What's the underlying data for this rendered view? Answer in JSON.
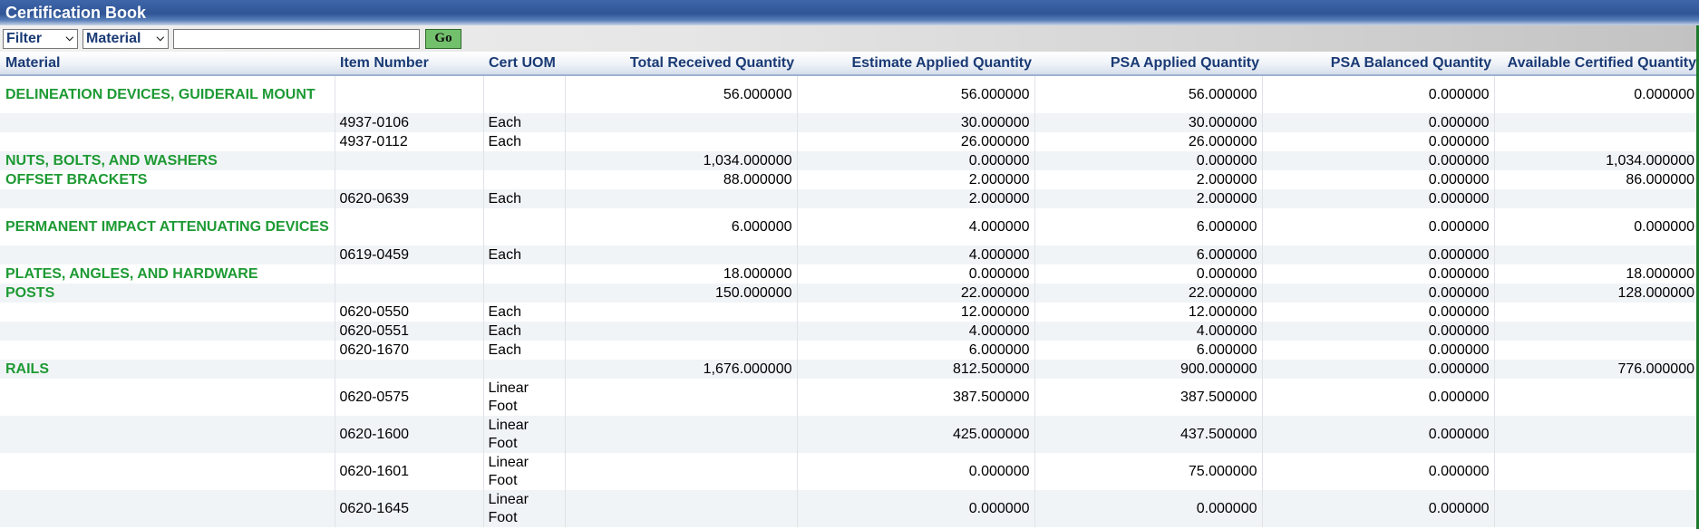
{
  "window": {
    "title": "Certification Book"
  },
  "toolbar": {
    "filter_select": "Filter",
    "field_select": "Material",
    "search_value": "",
    "go_label": "Go"
  },
  "table": {
    "columns": [
      "Material",
      "Item Number",
      "Cert UOM",
      "Total Received Quantity",
      "Estimate Applied Quantity",
      "PSA Applied Quantity",
      "PSA Balanced Quantity",
      "Available Certified Quantity"
    ],
    "rows": [
      {
        "type": "material",
        "material": "DELINEATION DEVICES, GUIDERAIL MOUNT",
        "item": "",
        "uom": "",
        "received": "56.000000",
        "estimate": "56.000000",
        "psa_applied": "56.000000",
        "psa_balanced": "0.000000",
        "available": "0.000000"
      },
      {
        "type": "item",
        "material": "",
        "item": "4937-0106",
        "uom": "Each",
        "received": "",
        "estimate": "30.000000",
        "psa_applied": "30.000000",
        "psa_balanced": "0.000000",
        "available": ""
      },
      {
        "type": "item",
        "material": "",
        "item": "4937-0112",
        "uom": "Each",
        "received": "",
        "estimate": "26.000000",
        "psa_applied": "26.000000",
        "psa_balanced": "0.000000",
        "available": ""
      },
      {
        "type": "material",
        "material": "NUTS, BOLTS, AND WASHERS",
        "item": "",
        "uom": "",
        "received": "1,034.000000",
        "estimate": "0.000000",
        "psa_applied": "0.000000",
        "psa_balanced": "0.000000",
        "available": "1,034.000000"
      },
      {
        "type": "material",
        "material": "OFFSET BRACKETS",
        "item": "",
        "uom": "",
        "received": "88.000000",
        "estimate": "2.000000",
        "psa_applied": "2.000000",
        "psa_balanced": "0.000000",
        "available": "86.000000"
      },
      {
        "type": "item",
        "material": "",
        "item": "0620-0639",
        "uom": "Each",
        "received": "",
        "estimate": "2.000000",
        "psa_applied": "2.000000",
        "psa_balanced": "0.000000",
        "available": ""
      },
      {
        "type": "material",
        "material": "PERMANENT IMPACT ATTENUATING DEVICES",
        "item": "",
        "uom": "",
        "received": "6.000000",
        "estimate": "4.000000",
        "psa_applied": "6.000000",
        "psa_balanced": "0.000000",
        "available": "0.000000"
      },
      {
        "type": "item",
        "material": "",
        "item": "0619-0459",
        "uom": "Each",
        "received": "",
        "estimate": "4.000000",
        "psa_applied": "6.000000",
        "psa_balanced": "0.000000",
        "available": ""
      },
      {
        "type": "material",
        "material": "PLATES, ANGLES, AND HARDWARE",
        "item": "",
        "uom": "",
        "received": "18.000000",
        "estimate": "0.000000",
        "psa_applied": "0.000000",
        "psa_balanced": "0.000000",
        "available": "18.000000"
      },
      {
        "type": "material",
        "material": "POSTS",
        "item": "",
        "uom": "",
        "received": "150.000000",
        "estimate": "22.000000",
        "psa_applied": "22.000000",
        "psa_balanced": "0.000000",
        "available": "128.000000"
      },
      {
        "type": "item",
        "material": "",
        "item": "0620-0550",
        "uom": "Each",
        "received": "",
        "estimate": "12.000000",
        "psa_applied": "12.000000",
        "psa_balanced": "0.000000",
        "available": ""
      },
      {
        "type": "item",
        "material": "",
        "item": "0620-0551",
        "uom": "Each",
        "received": "",
        "estimate": "4.000000",
        "psa_applied": "4.000000",
        "psa_balanced": "0.000000",
        "available": ""
      },
      {
        "type": "item",
        "material": "",
        "item": "0620-1670",
        "uom": "Each",
        "received": "",
        "estimate": "6.000000",
        "psa_applied": "6.000000",
        "psa_balanced": "0.000000",
        "available": ""
      },
      {
        "type": "material",
        "material": "RAILS",
        "item": "",
        "uom": "",
        "received": "1,676.000000",
        "estimate": "812.500000",
        "psa_applied": "900.000000",
        "psa_balanced": "0.000000",
        "available": "776.000000"
      },
      {
        "type": "item",
        "material": "",
        "item": "0620-0575",
        "uom": "Linear Foot",
        "received": "",
        "estimate": "387.500000",
        "psa_applied": "387.500000",
        "psa_balanced": "0.000000",
        "available": ""
      },
      {
        "type": "item",
        "material": "",
        "item": "0620-1600",
        "uom": "Linear Foot",
        "received": "",
        "estimate": "425.000000",
        "psa_applied": "437.500000",
        "psa_balanced": "0.000000",
        "available": ""
      },
      {
        "type": "item",
        "material": "",
        "item": "0620-1601",
        "uom": "Linear Foot",
        "received": "",
        "estimate": "0.000000",
        "psa_applied": "75.000000",
        "psa_balanced": "0.000000",
        "available": ""
      },
      {
        "type": "item",
        "material": "",
        "item": "0620-1645",
        "uom": "Linear Foot",
        "received": "",
        "estimate": "0.000000",
        "psa_applied": "0.000000",
        "psa_balanced": "0.000000",
        "available": ""
      }
    ]
  }
}
